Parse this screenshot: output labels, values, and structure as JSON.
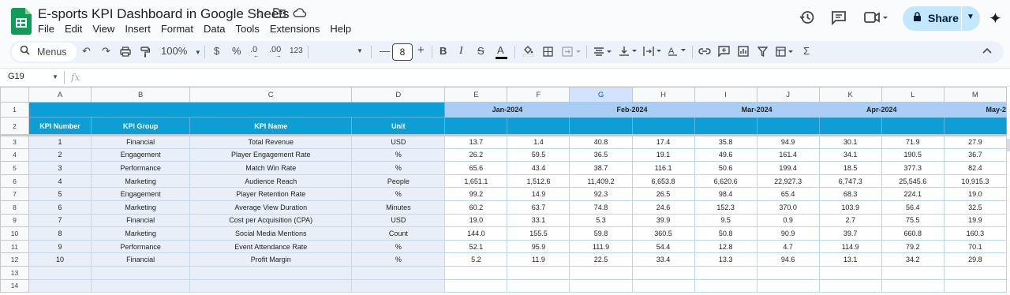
{
  "doc": {
    "title": "E-sports KPI Dashboard in Google Sheets"
  },
  "menu": [
    "File",
    "Edit",
    "View",
    "Insert",
    "Format",
    "Data",
    "Tools",
    "Extensions",
    "Help"
  ],
  "share": {
    "label": "Share"
  },
  "toolbar": {
    "menus_label": "Menus",
    "zoom": "100%",
    "currency": "$",
    "percent": "%",
    "dec_minus": ".0",
    "dec_plus": ".00",
    "number_format": "123",
    "font_size": "8"
  },
  "formula_bar": {
    "cell_ref": "G19",
    "fx": "fx"
  },
  "columns": [
    "A",
    "B",
    "C",
    "D",
    "E",
    "F",
    "G",
    "H",
    "I",
    "J",
    "K",
    "L",
    "M"
  ],
  "selected_column": "G",
  "row_numbers": [
    "1",
    "2",
    "3",
    "4",
    "5",
    "6",
    "7",
    "8",
    "9",
    "10",
    "11",
    "12",
    "13",
    "14"
  ],
  "months": [
    "Jan-2024",
    "Feb-2024",
    "Mar-2024",
    "Apr-2024",
    "May-2"
  ],
  "headers": [
    "KPI Number",
    "KPI Group",
    "KPI Name",
    "Unit"
  ],
  "kpis": [
    {
      "num": "1",
      "group": "Financial",
      "name": "Total Revenue",
      "unit": "USD",
      "vals": [
        "13.7",
        "1.4",
        "40.8",
        "17.4",
        "35.8",
        "94.9",
        "30.1",
        "71.9",
        "27.9"
      ]
    },
    {
      "num": "2",
      "group": "Engagement",
      "name": "Player Engagement Rate",
      "unit": "%",
      "vals": [
        "26.2",
        "59.5",
        "36.5",
        "19.1",
        "49.6",
        "161.4",
        "34.1",
        "190.5",
        "36.7"
      ]
    },
    {
      "num": "3",
      "group": "Performance",
      "name": "Match Win Rate",
      "unit": "%",
      "vals": [
        "65.6",
        "43.4",
        "38.7",
        "116.1",
        "50.6",
        "199.4",
        "18.5",
        "377.3",
        "82.4"
      ]
    },
    {
      "num": "4",
      "group": "Marketing",
      "name": "Audience Reach",
      "unit": "People",
      "vals": [
        "1,651.1",
        "1,512.6",
        "11,409.2",
        "6,653.8",
        "6,620.6",
        "22,927.3",
        "6,747.3",
        "25,545.6",
        "10,915.3"
      ]
    },
    {
      "num": "5",
      "group": "Engagement",
      "name": "Player Retention Rate",
      "unit": "%",
      "vals": [
        "99.2",
        "14.9",
        "92.3",
        "26.5",
        "98.4",
        "65.4",
        "68.3",
        "224.1",
        "19.0"
      ]
    },
    {
      "num": "6",
      "group": "Marketing",
      "name": "Average View Duration",
      "unit": "Minutes",
      "vals": [
        "60.2",
        "63.7",
        "74.8",
        "24.6",
        "152.3",
        "370.0",
        "103.9",
        "56.4",
        "32.5"
      ]
    },
    {
      "num": "7",
      "group": "Financial",
      "name": "Cost per Acquisition (CPA)",
      "unit": "USD",
      "vals": [
        "19.0",
        "33.1",
        "5.3",
        "39.9",
        "9.5",
        "0.9",
        "2.7",
        "75.5",
        "19.9"
      ]
    },
    {
      "num": "8",
      "group": "Marketing",
      "name": "Social Media Mentions",
      "unit": "Count",
      "vals": [
        "144.0",
        "155.5",
        "59.8",
        "360.5",
        "50.8",
        "90.9",
        "39.7",
        "660.8",
        "160.3"
      ]
    },
    {
      "num": "9",
      "group": "Performance",
      "name": "Event Attendance Rate",
      "unit": "%",
      "vals": [
        "52.1",
        "95.9",
        "111.9",
        "54.4",
        "12.8",
        "4.7",
        "114.9",
        "79.2",
        "70.1"
      ]
    },
    {
      "num": "10",
      "group": "Financial",
      "name": "Profit Margin",
      "unit": "%",
      "vals": [
        "5.2",
        "11.9",
        "22.5",
        "33.4",
        "13.3",
        "94.6",
        "13.1",
        "34.2",
        "29.8"
      ]
    }
  ],
  "colors": {
    "header_blue": "#0e9ed6",
    "month_blue": "#a9cef4",
    "index_fill": "#e8eff9",
    "share_bg": "#c2e7ff",
    "logo_green": "#0f9d58"
  }
}
